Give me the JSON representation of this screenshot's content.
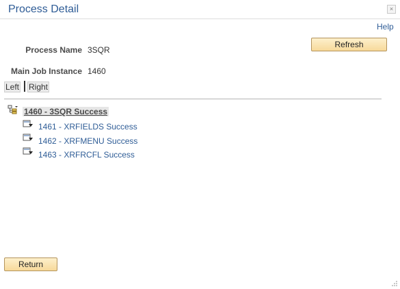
{
  "window": {
    "title": "Process Detail",
    "close_glyph": "×"
  },
  "header": {
    "help_label": "Help"
  },
  "fields": {
    "process_name_label": "Process Name",
    "process_name_value": "3SQR",
    "main_job_instance_label": "Main Job Instance",
    "main_job_instance_value": "1460"
  },
  "actions": {
    "refresh_label": "Refresh",
    "return_label": "Return"
  },
  "nav": {
    "left_label": "Left",
    "right_label": "Right"
  },
  "tree": {
    "root": {
      "label": "1460 - 3SQR Success",
      "icon": "job-tree-icon"
    },
    "children": [
      {
        "label": "1461 - XRFIELDS Success",
        "icon": "process-icon"
      },
      {
        "label": "1462 - XRFMENU Success",
        "icon": "process-icon"
      },
      {
        "label": "1463 - XRFRCFL Success",
        "icon": "process-icon"
      }
    ]
  },
  "colors": {
    "title": "#2e5c96",
    "link": "#2e5c96",
    "button_top": "#fdf0cc",
    "button_bottom": "#f7d99a",
    "button_border": "#b3935b"
  }
}
